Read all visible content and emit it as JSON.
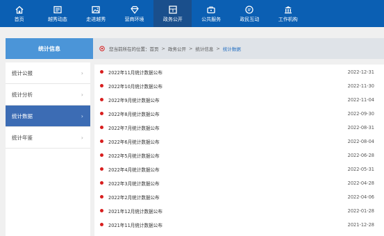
{
  "topnav": {
    "items": [
      {
        "label": "首页",
        "icon": "home-icon"
      },
      {
        "label": "越秀动态",
        "icon": "news-icon"
      },
      {
        "label": "走进越秀",
        "icon": "image-icon"
      },
      {
        "label": "营商环境",
        "icon": "diamond-icon"
      },
      {
        "label": "政务公开",
        "icon": "board-icon",
        "active": true
      },
      {
        "label": "公共服务",
        "icon": "briefcase-icon"
      },
      {
        "label": "政民互动",
        "icon": "chat-icon"
      },
      {
        "label": "工作机构",
        "icon": "building-icon"
      }
    ]
  },
  "sidebar": {
    "header": "统计信息",
    "items": [
      {
        "label": "统计公报"
      },
      {
        "label": "统计分析"
      },
      {
        "label": "统计数据",
        "active": true
      },
      {
        "label": "统计年鉴"
      }
    ],
    "chevron": "›"
  },
  "breadcrumb": {
    "prefix": "您当前所在的位置：",
    "items": [
      "首页",
      "政务公开",
      "统计信息",
      "统计数据"
    ],
    "separator": ">"
  },
  "articles": [
    {
      "title": "2022年11月统计数据公布",
      "date": "2022-12-31"
    },
    {
      "title": "2022年10月统计数据公布",
      "date": "2022-11-30"
    },
    {
      "title": "2022年9月统计数据公布",
      "date": "2022-11-04"
    },
    {
      "title": "2022年8月统计数据公布",
      "date": "2022-09-30"
    },
    {
      "title": "2022年7月统计数据公布",
      "date": "2022-08-31"
    },
    {
      "title": "2022年6月统计数据公布",
      "date": "2022-08-04"
    },
    {
      "title": "2022年5月统计数据公布",
      "date": "2022-06-28"
    },
    {
      "title": "2022年4月统计数据公布",
      "date": "2022-05-31"
    },
    {
      "title": "2022年3月统计数据公布",
      "date": "2022-04-28"
    },
    {
      "title": "2022年2月统计数据公布",
      "date": "2022-04-06"
    },
    {
      "title": "2021年12月统计数据公布",
      "date": "2022-01-28"
    },
    {
      "title": "2021年11月统计数据公布",
      "date": "2021-12-28"
    }
  ],
  "colors": {
    "nav_bg": "#0b5fb3",
    "nav_active": "#1a4f8c",
    "sidebar_header": "#4b95d8",
    "sidebar_active": "#3c6cb4",
    "bullet": "#d81e1e",
    "crumb_current": "#1f6cc0"
  }
}
